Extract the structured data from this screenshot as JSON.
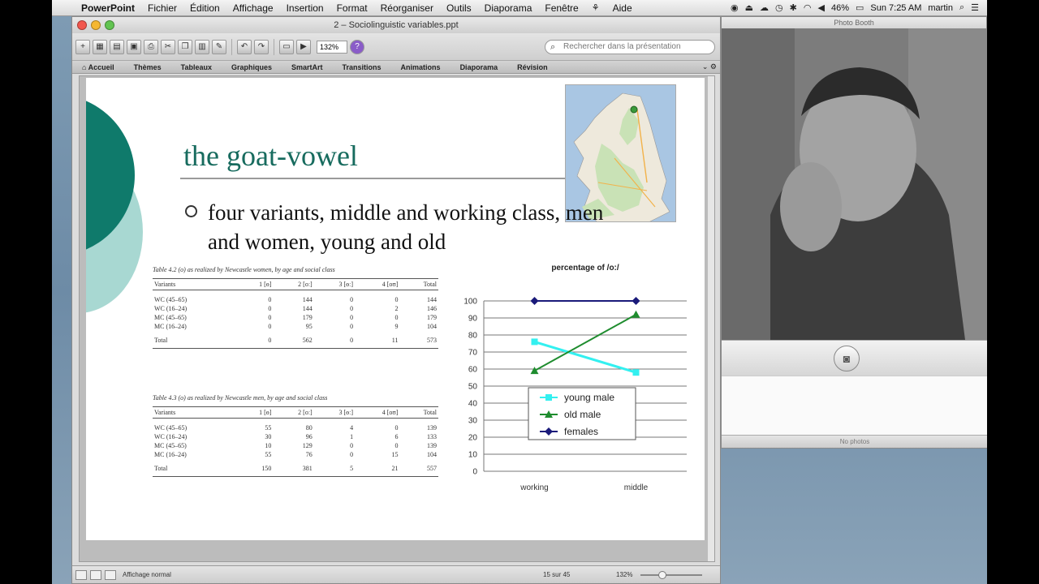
{
  "menubar": {
    "app": "PowerPoint",
    "items": [
      "Fichier",
      "Édition",
      "Affichage",
      "Insertion",
      "Format",
      "Réorganiser",
      "Outils",
      "Diaporama",
      "Fenêtre",
      "Aide"
    ],
    "battery": "46%",
    "clock": "Sun 7:25 AM",
    "user": "martin"
  },
  "ppt": {
    "window_title": "2 – Sociolinguistic variables.ppt",
    "zoom": "132%",
    "search_placeholder": "Rechercher dans la présentation",
    "ribbon_tabs": [
      "Accueil",
      "Thèmes",
      "Tableaux",
      "Graphiques",
      "SmartArt",
      "Transitions",
      "Animations",
      "Diaporama",
      "Révision"
    ],
    "status_view": "Affichage normal",
    "slide_count": "15 sur 45",
    "status_zoom": "132%"
  },
  "slide": {
    "title": "the goat-vowel",
    "bullet": "four variants, middle and working class, men and women, young and old",
    "table_women": {
      "caption": "Table 4.2   (o) as realized by Newcastle women, by age and social class",
      "headers": [
        "Variants",
        "1 [ɵ]",
        "2 [oː]",
        "3 [ɵː]",
        "4 [oʊ]",
        "Total"
      ],
      "rows": [
        [
          "WC (45–65)",
          "0",
          "144",
          "0",
          "0",
          "144"
        ],
        [
          "WC (16–24)",
          "0",
          "144",
          "0",
          "2",
          "146"
        ],
        [
          "MC (45–65)",
          "0",
          "179",
          "0",
          "0",
          "179"
        ],
        [
          "MC (16–24)",
          "0",
          "95",
          "0",
          "9",
          "104"
        ]
      ],
      "total": [
        "Total",
        "0",
        "562",
        "0",
        "11",
        "573"
      ]
    },
    "table_men": {
      "caption": "Table 4.3   (o) as realized by Newcastle men, by age and social class",
      "headers": [
        "Variants",
        "1 [ɵ]",
        "2 [oː]",
        "3 [ɵː]",
        "4 [oʊ]",
        "Total"
      ],
      "rows": [
        [
          "WC (45–65)",
          "55",
          "80",
          "4",
          "0",
          "139"
        ],
        [
          "WC (16–24)",
          "30",
          "96",
          "1",
          "6",
          "133"
        ],
        [
          "MC (45–65)",
          "10",
          "129",
          "0",
          "0",
          "139"
        ],
        [
          "MC (16–24)",
          "55",
          "76",
          "0",
          "15",
          "104"
        ]
      ],
      "total": [
        "Total",
        "150",
        "381",
        "5",
        "21",
        "557"
      ]
    }
  },
  "chart_data": {
    "type": "line",
    "title": "percentage of /o:/",
    "categories": [
      "working",
      "middle"
    ],
    "series": [
      {
        "name": "young male",
        "values": [
          76,
          58
        ],
        "color": "#33f0f0",
        "marker": "square"
      },
      {
        "name": "old male",
        "values": [
          59,
          92
        ],
        "color": "#1e8c2e",
        "marker": "triangle"
      },
      {
        "name": "females",
        "values": [
          100,
          100
        ],
        "color": "#1a1a7a",
        "marker": "diamond"
      }
    ],
    "ylim": [
      0,
      100
    ],
    "yticks": [
      "0",
      "10",
      "20",
      "30",
      "40",
      "50",
      "60",
      "70",
      "80",
      "90",
      "100"
    ],
    "grid": true,
    "legend": "center-bottom"
  },
  "photobooth": {
    "title": "Photo Booth",
    "status": "No photos"
  },
  "colors": {
    "accent_dark": "#0f7a6b",
    "accent_light": "#a8d8d2",
    "title_text": "#176b5e"
  }
}
